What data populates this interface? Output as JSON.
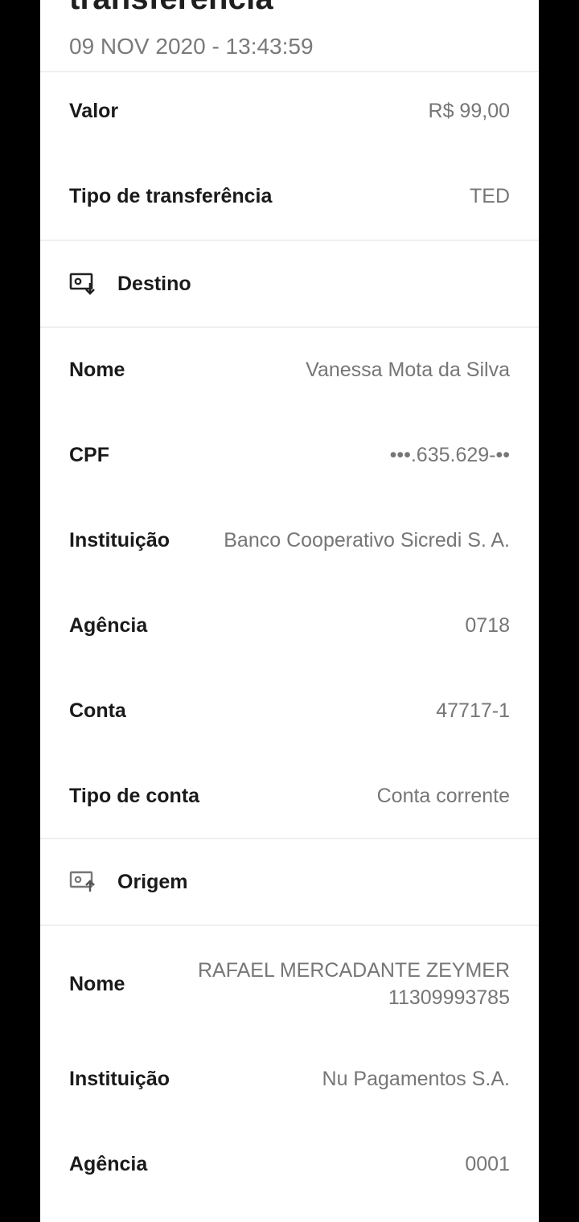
{
  "header": {
    "title": "transferência",
    "datetime": "09 NOV 2020 - 13:43:59"
  },
  "summary": {
    "valor_label": "Valor",
    "valor_value": "R$ 99,00",
    "tipo_label": "Tipo de transferência",
    "tipo_value": "TED"
  },
  "destino": {
    "section_label": "Destino",
    "icon": "money-in-icon",
    "nome_label": "Nome",
    "nome_value": "Vanessa Mota da Silva",
    "cpf_label": "CPF",
    "cpf_value": "•••.635.629-••",
    "instituicao_label": "Instituição",
    "instituicao_value": "Banco Cooperativo Sicredi S. A.",
    "agencia_label": "Agência",
    "agencia_value": "0718",
    "conta_label": "Conta",
    "conta_value": "47717-1",
    "tipo_conta_label": "Tipo de conta",
    "tipo_conta_value": "Conta corrente"
  },
  "origem": {
    "section_label": "Origem",
    "icon": "money-out-icon",
    "nome_label": "Nome",
    "nome_value": "RAFAEL MERCADANTE ZEYMER 11309993785",
    "instituicao_label": "Instituição",
    "instituicao_value": "Nu Pagamentos S.A.",
    "agencia_label": "Agência",
    "agencia_value": "0001"
  },
  "colors": {
    "background": "#000000",
    "card": "#ffffff",
    "label": "#1a1a1a",
    "value": "#767676",
    "divider": "#f0f0f0"
  }
}
